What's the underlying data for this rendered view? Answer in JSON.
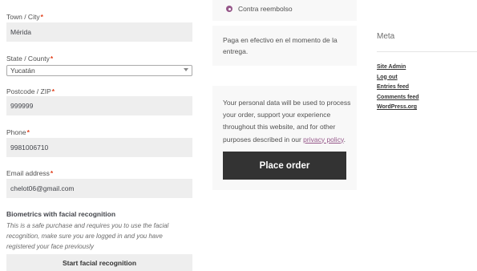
{
  "billing": {
    "town": {
      "label": "Town / City",
      "value": "Mérida"
    },
    "state": {
      "label": "State / County",
      "value": "Yucatán"
    },
    "postcode": {
      "label": "Postcode / ZIP",
      "value": "999999"
    },
    "phone": {
      "label": "Phone",
      "value": "9981006710"
    },
    "email": {
      "label": "Email address",
      "value": "chelot06@gmail.com"
    },
    "required_mark": "*"
  },
  "biometrics": {
    "title": "Biometrics with facial recognition",
    "description": "This is a safe purchase and requires you to use the facial recognition, make sure you are logged in and you have registered your face previously",
    "button_label": "Start facial recognition"
  },
  "payment": {
    "method_label": "Contra reembolso",
    "method_description": "Paga en efectivo en el momento de la entrega.",
    "privacy_text": "Your personal data will be used to process your order, support your experience throughout this website, and for other purposes described in our ",
    "privacy_link": "privacy policy",
    "privacy_end": ".",
    "place_order_label": "Place order",
    "accent_color": "#96588a"
  },
  "sidebar": {
    "meta_title": "Meta",
    "links": [
      "Site Admin",
      "Log out",
      "Entries feed",
      "Comments feed",
      "WordPress.org"
    ]
  }
}
